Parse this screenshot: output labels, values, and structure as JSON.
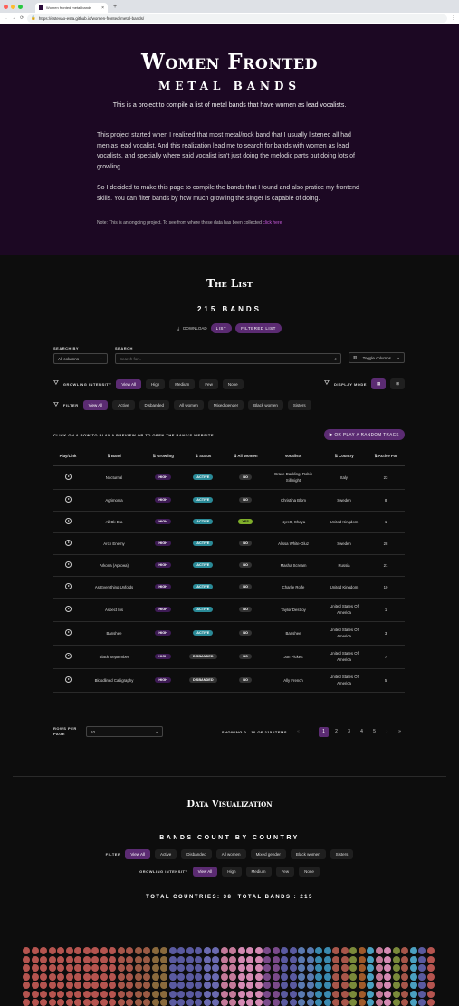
{
  "browser": {
    "tab_title": "Women fronted metal bands",
    "url": "https://estevao-esta.github.io/women-fronted-metal-bands/"
  },
  "hero": {
    "title": "Women Fronted",
    "subtitle": "METAL BANDS",
    "lead": "This is a project to compile a list of metal bands that have women as lead vocalists.",
    "p1": "This project started when I realized that most metal/rock band that I usually listened all had men as lead vocalist. And this realization lead me to search for bands with women as lead vocalists, and specially where said vocalist isn't just doing the melodic parts but doing lots of growling.",
    "p2": "So I decided to make this page to compile the bands that I found and also pratice my frontend skills. You can filter bands by how much growling the singer is capable of doing.",
    "note": "Note: This is an ongoing project. To see from where these data has been collected ",
    "note_link": "click here"
  },
  "list": {
    "title": "The List",
    "count": "215 BANDS",
    "download": "DOWNLOAD",
    "btn_list": "LIST",
    "btn_filtered": "FILTERED LIST",
    "search_by_label": "SEARCH BY",
    "search_by_value": "All columns",
    "search_label": "SEARCH",
    "search_placeholder": "Search for...",
    "toggle_columns": "Toggle columns",
    "growl_label": "GROWLING INTENSITY",
    "growl_chips": [
      "View All",
      "High",
      "Medium",
      "Few",
      "None"
    ],
    "display_mode": "DISPLAY MODE",
    "filter_label": "FILTER",
    "filter_chips": [
      "View All",
      "Active",
      "Disbanded",
      "All women",
      "Mixed gender",
      "Black women",
      "Sisters"
    ],
    "click_hint": "CLICK ON A ROW TO PLAY A PREVIEW OR TO OPEN THE BAND'S WEBSITE.",
    "random_btn": "OR PLAY A RANDOM TRACK",
    "headers": [
      "Play/Link",
      "⇅ Band",
      "⇅ Growling",
      "⇅ Status",
      "⇅ All Women",
      "Vocalists",
      "⇅ Country",
      "⇅ Active For"
    ],
    "rows": [
      {
        "band": "Nocturnal",
        "growl": "HIGH",
        "status": "ACTIVE",
        "women": "NO",
        "vocal": "Grace Darkling, Robin Sillmight",
        "country": "Italy",
        "active": "23"
      },
      {
        "band": "Agrimonia",
        "growl": "HIGH",
        "status": "ACTIVE",
        "women": "NO",
        "vocal": "Christina Blom",
        "country": "Sweden",
        "active": "8"
      },
      {
        "band": "All Bk Era",
        "growl": "HIGH",
        "status": "ACTIVE",
        "women": "YES",
        "vocal": "Nyrett, Chaya",
        "country": "United Kingdom",
        "active": "1"
      },
      {
        "band": "Arch Enemy",
        "growl": "HIGH",
        "status": "ACTIVE",
        "women": "NO",
        "vocal": "Alissa White-Gluz",
        "country": "Sweden",
        "active": "28"
      },
      {
        "band": "Arkona (Аркона)",
        "growl": "HIGH",
        "status": "ACTIVE",
        "women": "NO",
        "vocal": "Masha Scream",
        "country": "Russia",
        "active": "21"
      },
      {
        "band": "As Everything Unfolds",
        "growl": "HIGH",
        "status": "ACTIVE",
        "women": "NO",
        "vocal": "Charlie Rolfe",
        "country": "United Kingdom",
        "active": "10"
      },
      {
        "band": "Aspect Iris",
        "growl": "HIGH",
        "status": "ACTIVE",
        "women": "NO",
        "vocal": "Taylor Destroy",
        "country": "United States Of America",
        "active": "1"
      },
      {
        "band": "Banshee",
        "growl": "HIGH",
        "status": "ACTIVE",
        "women": "NO",
        "vocal": "Banshee",
        "country": "United States Of America",
        "active": "3"
      },
      {
        "band": "Black September",
        "growl": "HIGH",
        "status": "DISBANDED",
        "women": "NO",
        "vocal": "Jon Pickett",
        "country": "United States Of America",
        "active": "7"
      },
      {
        "band": "Bloodlined Calligraphy",
        "growl": "HIGH",
        "status": "DISBANDED",
        "women": "NO",
        "vocal": "Ally French",
        "country": "United States Of America",
        "active": "5"
      }
    ],
    "rows_per_page_label": "ROWS PER PAGE",
    "rows_per_page": "10",
    "showing": "SHOWING 0 - 10 OF 215 ITEMS",
    "pages": [
      "1",
      "2",
      "3",
      "4",
      "5"
    ]
  },
  "dataviz": {
    "title": "Data Visualization",
    "subtitle": "BANDS COUNT BY COUNTRY",
    "filter_label": "FILTER",
    "filter_chips": [
      "View All",
      "Active",
      "Disbanded",
      "All women",
      "Mixed gender",
      "Black women",
      "Sisters"
    ],
    "growl_label": "GROWLING INTENSITY",
    "growl_chips": [
      "View All",
      "High",
      "Medium",
      "Few",
      "None"
    ],
    "totals": "TOTAL COUNTRIES: 38  TOTAL BANDS : 215"
  },
  "colors": {
    "accent": "#5b2b72",
    "hero_bg": "#1c0823",
    "active": "#2a8a97",
    "yes": "#7fae2a"
  }
}
